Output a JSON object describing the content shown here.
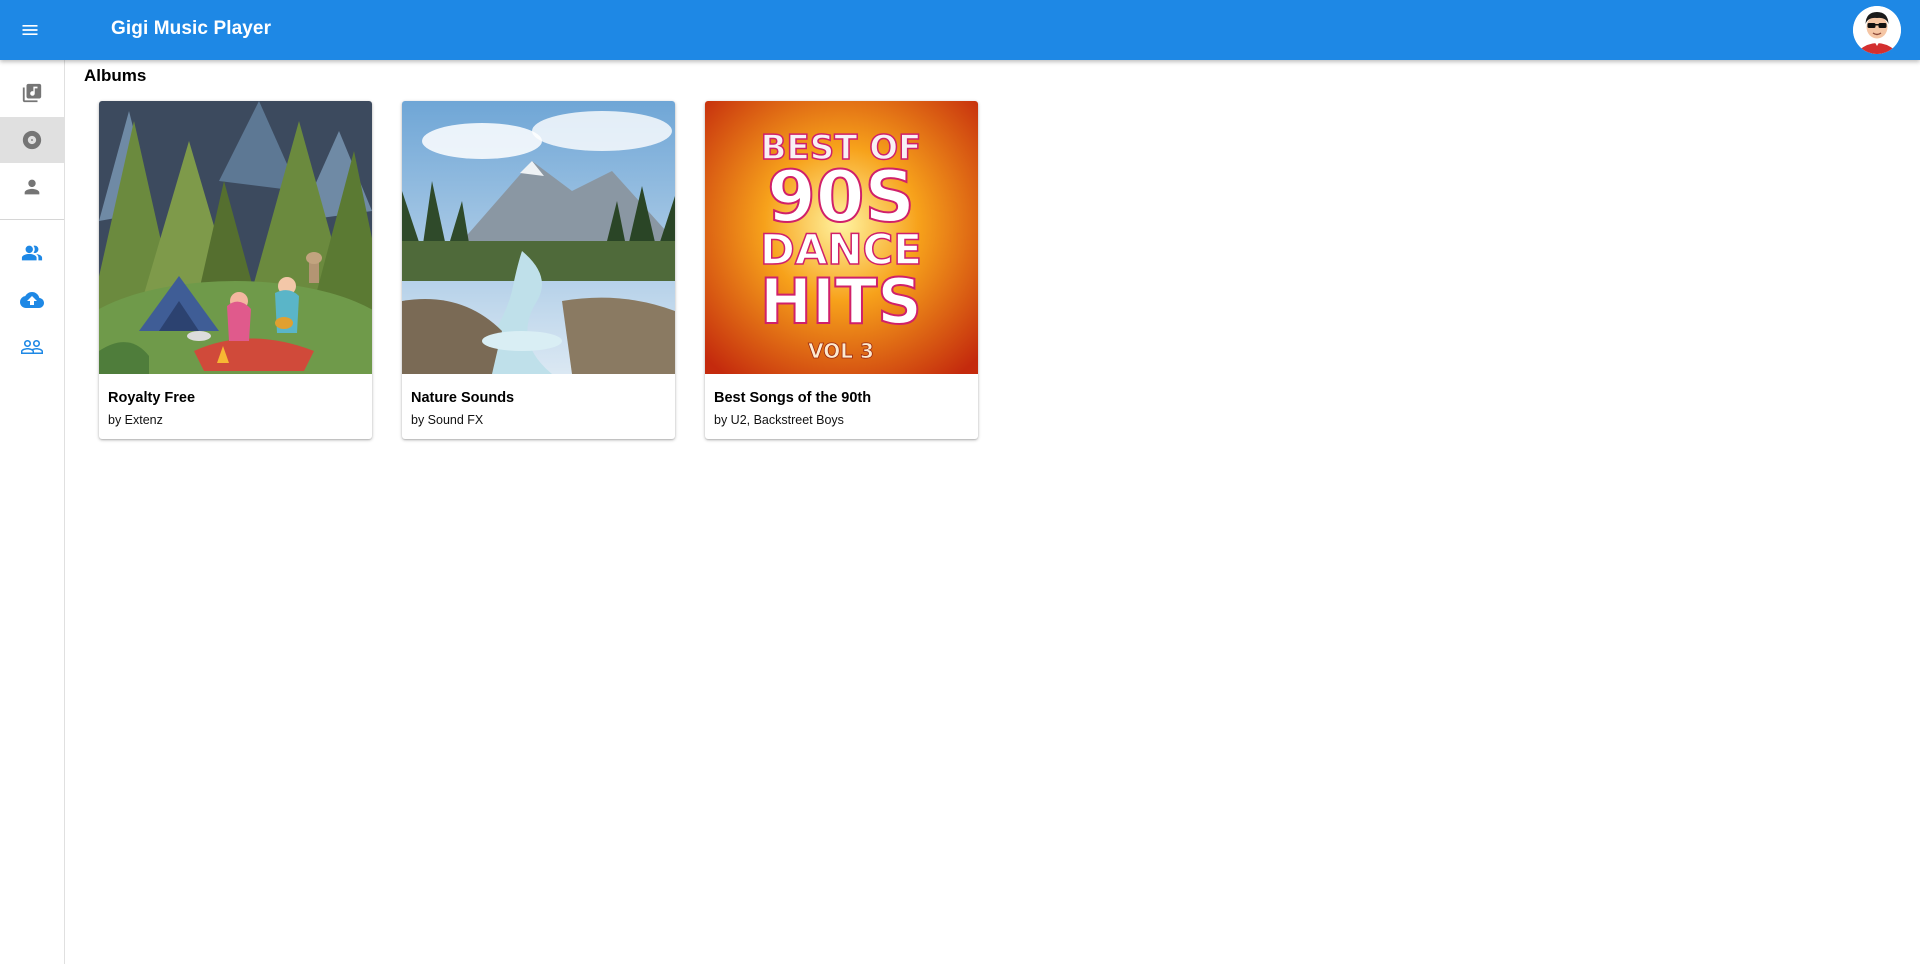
{
  "app": {
    "title": "Gigi Music Player"
  },
  "page": {
    "section_title": "Albums"
  },
  "colors": {
    "primary": "#1e88e5",
    "active_nav": "#e0e0e0",
    "nav_icon_gray": "#757575"
  },
  "sidebar": {
    "items": [
      {
        "icon": "library-music-icon",
        "active": false
      },
      {
        "icon": "album-icon",
        "active": true
      },
      {
        "icon": "person-icon",
        "active": false
      },
      {
        "icon": "people-icon",
        "active": false
      },
      {
        "icon": "cloud-upload-icon",
        "active": false
      },
      {
        "icon": "people-outline-icon",
        "active": false
      }
    ]
  },
  "albums": [
    {
      "title": "Royalty Free",
      "artist": "by Extenz",
      "cover": "campfire-forest-illustration"
    },
    {
      "title": "Nature Sounds",
      "artist": "by Sound FX",
      "cover": "mountain-river-photo"
    },
    {
      "title": "Best Songs of the 90th",
      "artist": "by U2, Backstreet Boys",
      "cover": "90s-dance-hits-cover",
      "cover_text": {
        "line1": "BEST OF",
        "line2": "90S",
        "line3": "DANCE",
        "line4": "HITS",
        "line5": "VOL 3"
      }
    }
  ]
}
